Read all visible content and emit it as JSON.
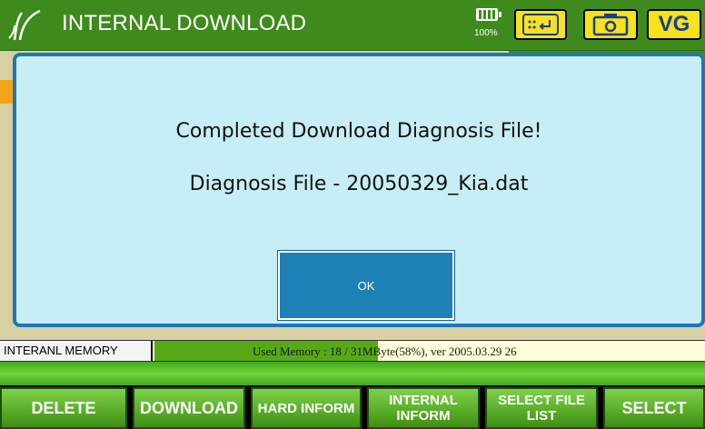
{
  "header": {
    "title": "INTERNAL DOWNLOAD",
    "battery_percent": "100%",
    "vg_label": "VG",
    "icons": {
      "logo": "scanner-logo-icon",
      "battery": "battery-icon",
      "keyboard": "keyboard-enter-icon",
      "camera": "camera-icon"
    }
  },
  "dialog": {
    "message": "Completed Download Diagnosis File!",
    "file_line": "Diagnosis File - 20050329_Kia.dat",
    "ok_label": "OK"
  },
  "memory": {
    "label": "INTERANL MEMORY",
    "used_fraction": 0.58,
    "text": "Used Memory : 18 / 31MByte(58%), ver 2005.03.29 26"
  },
  "buttons": [
    {
      "label": "DELETE"
    },
    {
      "label": "DOWNLOAD"
    },
    {
      "label": "HARD INFORM"
    },
    {
      "label": "INTERNAL INFORM"
    },
    {
      "label": "SELECT FILE LIST"
    },
    {
      "label": "SELECT"
    }
  ],
  "colors": {
    "title_bar": "#3f8a1d",
    "dialog_bg": "#c7eef6",
    "dialog_border": "#1e78b8",
    "ok_button": "#1e80b5",
    "accent_yellow": "#f7e21b"
  }
}
